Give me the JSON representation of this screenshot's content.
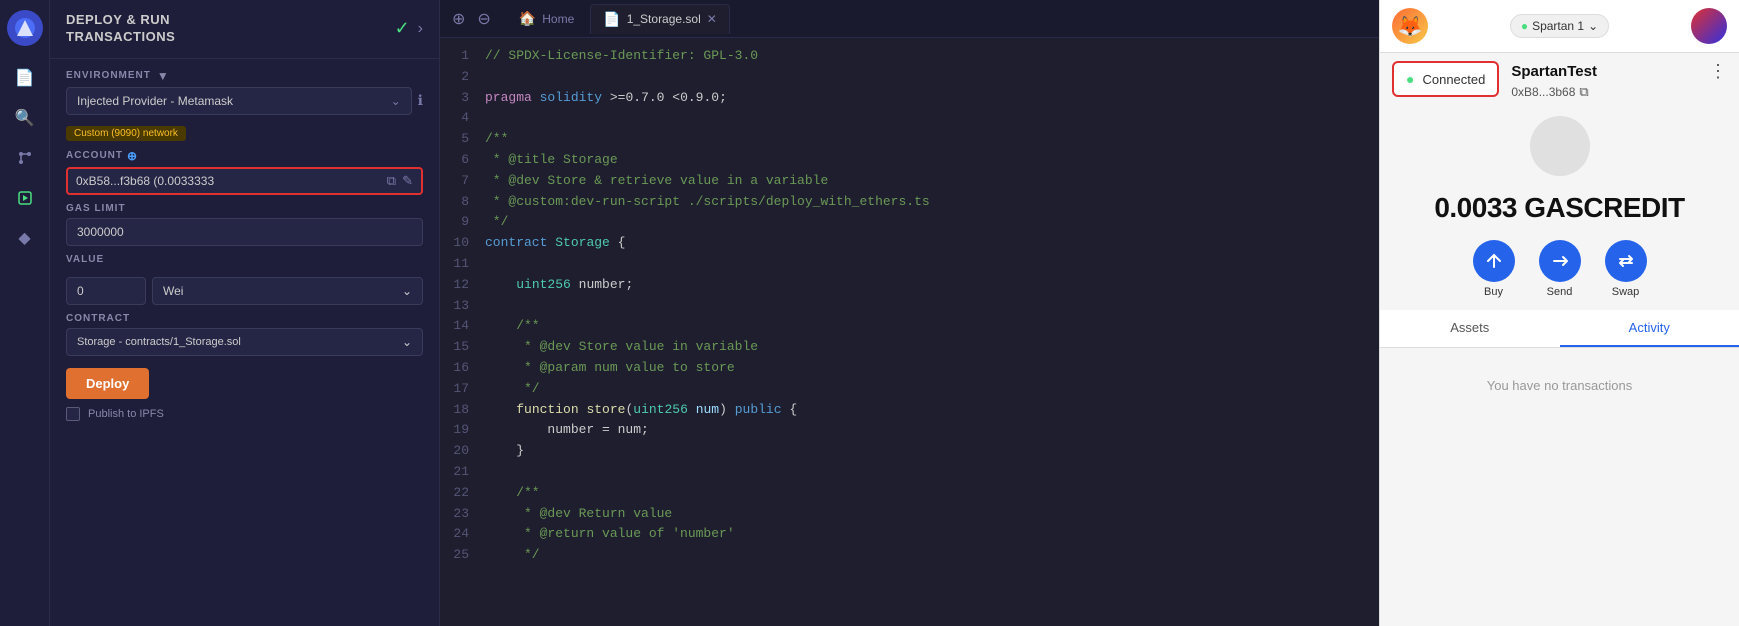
{
  "sidebar": {
    "logo": "🔷",
    "icons": [
      {
        "name": "files-icon",
        "symbol": "📄"
      },
      {
        "name": "search-icon",
        "symbol": "🔍"
      },
      {
        "name": "git-icon",
        "symbol": "⑂"
      },
      {
        "name": "deploy-icon",
        "symbol": "▶"
      },
      {
        "name": "plugin-icon",
        "symbol": "◆"
      }
    ]
  },
  "deploy_panel": {
    "title": "DEPLOY & RUN\nTRANSACTIONS",
    "environment_label": "ENVIRONMENT",
    "environment_value": "Injected Provider - Metamask",
    "network_badge": "Custom (9090) network",
    "account_label": "ACCOUNT",
    "account_value": "0xB58...f3b68 (0.0033333",
    "gas_limit_label": "GAS LIMIT",
    "gas_limit_value": "3000000",
    "value_label": "VALUE",
    "value_amount": "0",
    "value_unit": "Wei",
    "contract_label": "CONTRACT",
    "contract_value": "Storage - contracts/1_Storage.sol",
    "deploy_button": "Deploy",
    "publish_label": "Publish to IPFS"
  },
  "editor": {
    "home_tab": "Home",
    "file_tab": "1_Storage.sol",
    "lines": [
      {
        "num": 1,
        "code": "// SPDX-License-Identifier: GPL-3.0",
        "type": "comment"
      },
      {
        "num": 2,
        "code": "",
        "type": "normal"
      },
      {
        "num": 3,
        "code": "pragma solidity >=0.7.0 <0.9.0;",
        "type": "pragma"
      },
      {
        "num": 4,
        "code": "",
        "type": "normal"
      },
      {
        "num": 5,
        "code": "/**",
        "type": "comment"
      },
      {
        "num": 6,
        "code": " * @title Storage",
        "type": "comment"
      },
      {
        "num": 7,
        "code": " * @dev Store & retrieve value in a variable",
        "type": "comment"
      },
      {
        "num": 8,
        "code": " * @custom:dev-run-script ./scripts/deploy_with_ethers.ts",
        "type": "comment"
      },
      {
        "num": 9,
        "code": " */",
        "type": "comment"
      },
      {
        "num": 10,
        "code": "contract Storage {",
        "type": "contract"
      },
      {
        "num": 11,
        "code": "",
        "type": "normal"
      },
      {
        "num": 12,
        "code": "    uint256 number;",
        "type": "field"
      },
      {
        "num": 13,
        "code": "",
        "type": "normal"
      },
      {
        "num": 14,
        "code": "    /**",
        "type": "comment"
      },
      {
        "num": 15,
        "code": "     * @dev Store value in variable",
        "type": "comment"
      },
      {
        "num": 16,
        "code": "     * @param num value to store",
        "type": "comment"
      },
      {
        "num": 17,
        "code": "     */",
        "type": "comment"
      },
      {
        "num": 18,
        "code": "    function store(uint256 num) public {",
        "type": "function"
      },
      {
        "num": 19,
        "code": "        number = num;",
        "type": "normal"
      },
      {
        "num": 20,
        "code": "    }",
        "type": "normal"
      },
      {
        "num": 21,
        "code": "",
        "type": "normal"
      },
      {
        "num": 22,
        "code": "    /**",
        "type": "comment"
      },
      {
        "num": 23,
        "code": "     * @dev Return value",
        "type": "comment"
      },
      {
        "num": 24,
        "code": "     * @return value of 'number'",
        "type": "comment"
      },
      {
        "num": 25,
        "code": "     */",
        "type": "comment"
      }
    ]
  },
  "metamask": {
    "network_label": "Spartan 1",
    "connected_label": "Connected",
    "account_name": "SpartanTest",
    "account_address": "0xB8...3b68",
    "balance_amount": "0.0033",
    "balance_unit": "GASCREDIT",
    "buy_label": "Buy",
    "send_label": "Send",
    "swap_label": "Swap",
    "assets_tab": "Assets",
    "activity_tab": "Activity",
    "no_transactions": "You have no transactions"
  }
}
